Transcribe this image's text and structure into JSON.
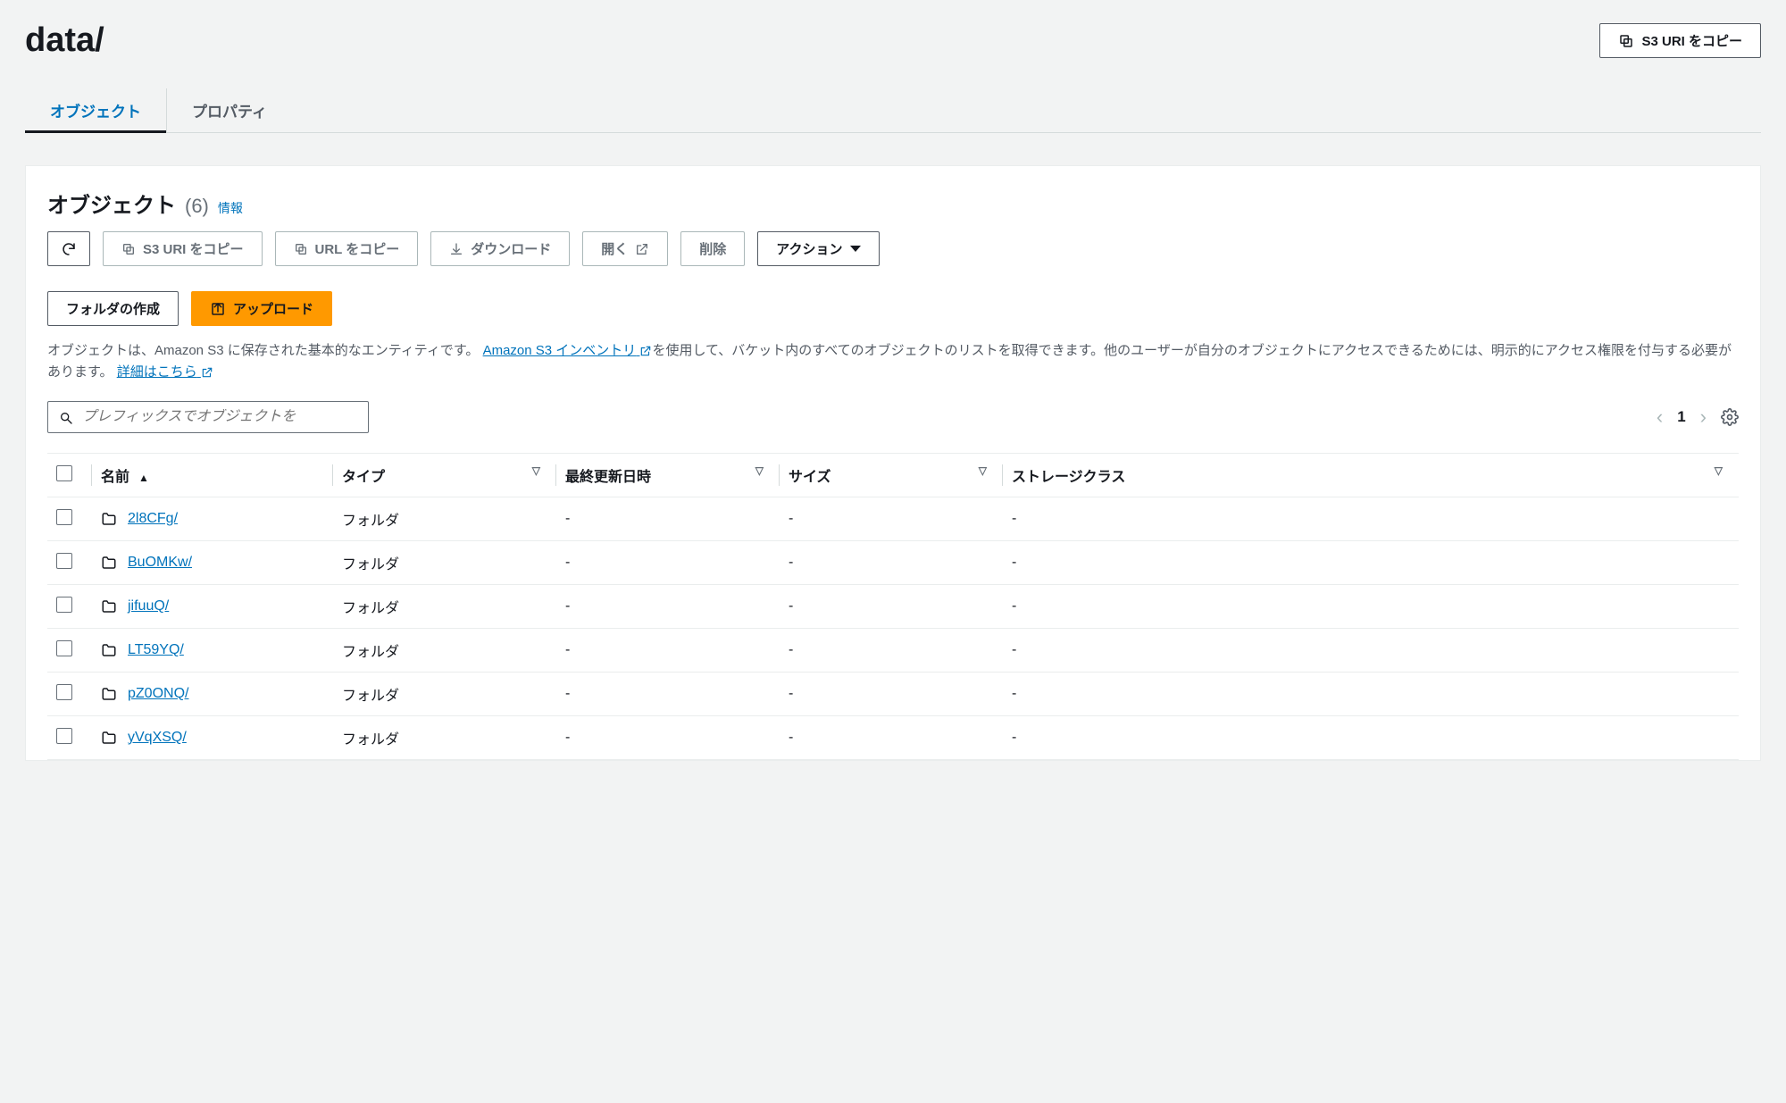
{
  "header": {
    "title": "data/",
    "copy_uri_label": "S3 URI をコピー"
  },
  "tabs": {
    "objects": "オブジェクト",
    "properties": "プロパティ"
  },
  "panel": {
    "title": "オブジェクト",
    "count": "(6)",
    "info_link": "情報",
    "toolbar": {
      "refresh": "",
      "copy_uri": "S3 URI をコピー",
      "copy_url": "URL をコピー",
      "download": "ダウンロード",
      "open": "開く",
      "delete": "削除",
      "actions": "アクション",
      "create_folder": "フォルダの作成",
      "upload": "アップロード"
    },
    "description": {
      "prefix": "オブジェクトは、Amazon S3 に保存された基本的なエンティティです。",
      "link1": "Amazon S3 インベントリ",
      "mid": "を使用して、バケット内のすべてのオブジェクトのリストを取得できます。他のユーザーが自分のオブジェクトにアクセスできるためには、明示的にアクセス権限を付与する必要があります。",
      "link2": "詳細はこちら"
    },
    "search_placeholder": "プレフィックスでオブジェクトを",
    "pager": {
      "page": "1"
    },
    "columns": {
      "name": "名前",
      "type": "タイプ",
      "last_modified": "最終更新日時",
      "size": "サイズ",
      "storage_class": "ストレージクラス"
    },
    "rows": [
      {
        "name": "2l8CFg/",
        "type": "フォルダ",
        "last_modified": "-",
        "size": "-",
        "storage_class": "-"
      },
      {
        "name": "BuOMKw/",
        "type": "フォルダ",
        "last_modified": "-",
        "size": "-",
        "storage_class": "-"
      },
      {
        "name": "jifuuQ/",
        "type": "フォルダ",
        "last_modified": "-",
        "size": "-",
        "storage_class": "-"
      },
      {
        "name": "LT59YQ/",
        "type": "フォルダ",
        "last_modified": "-",
        "size": "-",
        "storage_class": "-"
      },
      {
        "name": "pZ0ONQ/",
        "type": "フォルダ",
        "last_modified": "-",
        "size": "-",
        "storage_class": "-"
      },
      {
        "name": "yVqXSQ/",
        "type": "フォルダ",
        "last_modified": "-",
        "size": "-",
        "storage_class": "-"
      }
    ]
  }
}
